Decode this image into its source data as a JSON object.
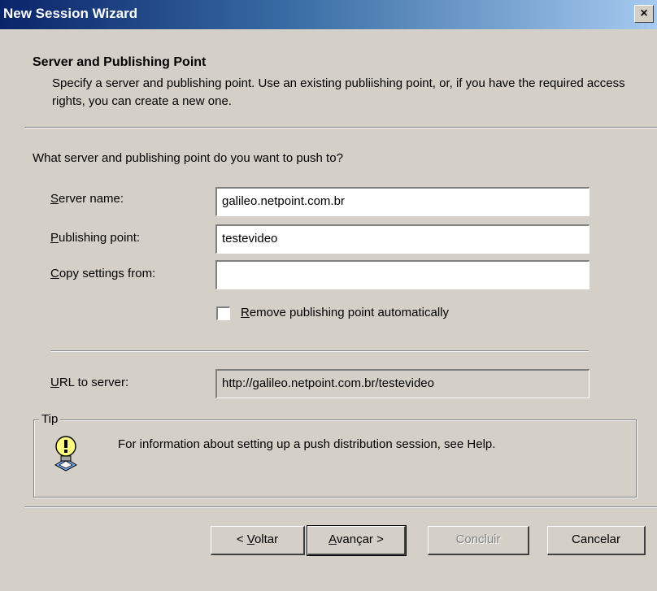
{
  "window": {
    "title": "New Session Wizard",
    "close_glyph": "×",
    "close_icon": "close-icon"
  },
  "header": {
    "title": "Server and Publishing Point",
    "description": "Specify a server and publishing point. Use an existing publiishing point, or, if you have the required access rights, you can create a new one."
  },
  "form": {
    "question": "What server and publishing point do you want to push to?",
    "server_name": {
      "label_mnemonic": "S",
      "label_rest": "erver name:",
      "value": "galileo.netpoint.com.br"
    },
    "publishing_point": {
      "label_mnemonic": "P",
      "label_rest": "ublishing point:",
      "value": "testevideo"
    },
    "copy_settings": {
      "label_mnemonic": "C",
      "label_rest": "opy settings from:",
      "value": ""
    },
    "remove_checkbox": {
      "label_mnemonic": "R",
      "label_rest": "emove publishing point automatically",
      "checked": false
    },
    "url": {
      "label_mnemonic": "U",
      "label_rest": "RL to server:",
      "value": "http://galileo.netpoint.com.br/testevideo"
    }
  },
  "tip": {
    "legend": "Tip",
    "icon": "lightbulb-tip-icon",
    "text": "For information about setting up a push distribution session, see Help."
  },
  "buttons": {
    "back": {
      "prefix": "< ",
      "mnemonic": "V",
      "rest": "oltar"
    },
    "next": {
      "mnemonic": "A",
      "rest": "vançar >"
    },
    "finish": {
      "label": "Concluir",
      "enabled": false
    },
    "cancel": {
      "label": "Cancelar"
    }
  }
}
